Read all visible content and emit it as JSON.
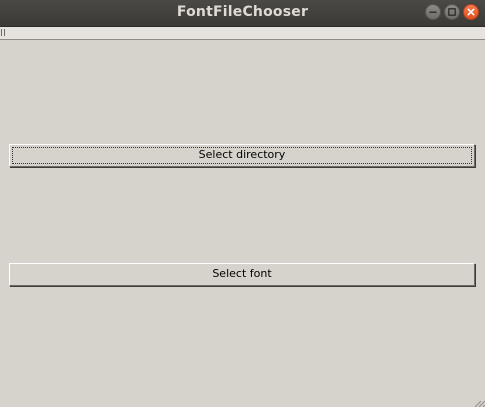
{
  "window": {
    "title": "FontFileChooser"
  },
  "buttons": {
    "select_directory": "Select directory",
    "select_font": "Select font"
  },
  "colors": {
    "background": "#d6d2cc",
    "titlebar": "#3c3b37",
    "close_button": "#e95420"
  },
  "icons": {
    "minimize": "minimize-icon",
    "maximize": "maximize-icon",
    "close": "close-icon",
    "grip": "grip-icon"
  }
}
